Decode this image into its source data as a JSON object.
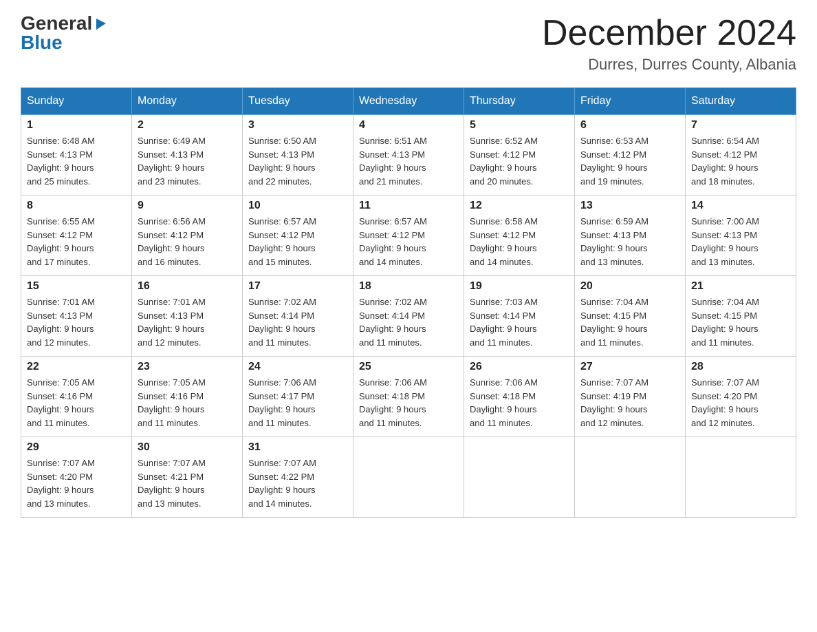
{
  "header": {
    "logo_general": "General",
    "logo_triangle": "▶",
    "logo_blue": "Blue",
    "month_title": "December 2024",
    "location": "Durres, Durres County, Albania"
  },
  "weekdays": [
    "Sunday",
    "Monday",
    "Tuesday",
    "Wednesday",
    "Thursday",
    "Friday",
    "Saturday"
  ],
  "weeks": [
    [
      {
        "day": "1",
        "sunrise": "6:48 AM",
        "sunset": "4:13 PM",
        "daylight": "9 hours and 25 minutes."
      },
      {
        "day": "2",
        "sunrise": "6:49 AM",
        "sunset": "4:13 PM",
        "daylight": "9 hours and 23 minutes."
      },
      {
        "day": "3",
        "sunrise": "6:50 AM",
        "sunset": "4:13 PM",
        "daylight": "9 hours and 22 minutes."
      },
      {
        "day": "4",
        "sunrise": "6:51 AM",
        "sunset": "4:13 PM",
        "daylight": "9 hours and 21 minutes."
      },
      {
        "day": "5",
        "sunrise": "6:52 AM",
        "sunset": "4:12 PM",
        "daylight": "9 hours and 20 minutes."
      },
      {
        "day": "6",
        "sunrise": "6:53 AM",
        "sunset": "4:12 PM",
        "daylight": "9 hours and 19 minutes."
      },
      {
        "day": "7",
        "sunrise": "6:54 AM",
        "sunset": "4:12 PM",
        "daylight": "9 hours and 18 minutes."
      }
    ],
    [
      {
        "day": "8",
        "sunrise": "6:55 AM",
        "sunset": "4:12 PM",
        "daylight": "9 hours and 17 minutes."
      },
      {
        "day": "9",
        "sunrise": "6:56 AM",
        "sunset": "4:12 PM",
        "daylight": "9 hours and 16 minutes."
      },
      {
        "day": "10",
        "sunrise": "6:57 AM",
        "sunset": "4:12 PM",
        "daylight": "9 hours and 15 minutes."
      },
      {
        "day": "11",
        "sunrise": "6:57 AM",
        "sunset": "4:12 PM",
        "daylight": "9 hours and 14 minutes."
      },
      {
        "day": "12",
        "sunrise": "6:58 AM",
        "sunset": "4:12 PM",
        "daylight": "9 hours and 14 minutes."
      },
      {
        "day": "13",
        "sunrise": "6:59 AM",
        "sunset": "4:13 PM",
        "daylight": "9 hours and 13 minutes."
      },
      {
        "day": "14",
        "sunrise": "7:00 AM",
        "sunset": "4:13 PM",
        "daylight": "9 hours and 13 minutes."
      }
    ],
    [
      {
        "day": "15",
        "sunrise": "7:01 AM",
        "sunset": "4:13 PM",
        "daylight": "9 hours and 12 minutes."
      },
      {
        "day": "16",
        "sunrise": "7:01 AM",
        "sunset": "4:13 PM",
        "daylight": "9 hours and 12 minutes."
      },
      {
        "day": "17",
        "sunrise": "7:02 AM",
        "sunset": "4:14 PM",
        "daylight": "9 hours and 11 minutes."
      },
      {
        "day": "18",
        "sunrise": "7:02 AM",
        "sunset": "4:14 PM",
        "daylight": "9 hours and 11 minutes."
      },
      {
        "day": "19",
        "sunrise": "7:03 AM",
        "sunset": "4:14 PM",
        "daylight": "9 hours and 11 minutes."
      },
      {
        "day": "20",
        "sunrise": "7:04 AM",
        "sunset": "4:15 PM",
        "daylight": "9 hours and 11 minutes."
      },
      {
        "day": "21",
        "sunrise": "7:04 AM",
        "sunset": "4:15 PM",
        "daylight": "9 hours and 11 minutes."
      }
    ],
    [
      {
        "day": "22",
        "sunrise": "7:05 AM",
        "sunset": "4:16 PM",
        "daylight": "9 hours and 11 minutes."
      },
      {
        "day": "23",
        "sunrise": "7:05 AM",
        "sunset": "4:16 PM",
        "daylight": "9 hours and 11 minutes."
      },
      {
        "day": "24",
        "sunrise": "7:06 AM",
        "sunset": "4:17 PM",
        "daylight": "9 hours and 11 minutes."
      },
      {
        "day": "25",
        "sunrise": "7:06 AM",
        "sunset": "4:18 PM",
        "daylight": "9 hours and 11 minutes."
      },
      {
        "day": "26",
        "sunrise": "7:06 AM",
        "sunset": "4:18 PM",
        "daylight": "9 hours and 11 minutes."
      },
      {
        "day": "27",
        "sunrise": "7:07 AM",
        "sunset": "4:19 PM",
        "daylight": "9 hours and 12 minutes."
      },
      {
        "day": "28",
        "sunrise": "7:07 AM",
        "sunset": "4:20 PM",
        "daylight": "9 hours and 12 minutes."
      }
    ],
    [
      {
        "day": "29",
        "sunrise": "7:07 AM",
        "sunset": "4:20 PM",
        "daylight": "9 hours and 13 minutes."
      },
      {
        "day": "30",
        "sunrise": "7:07 AM",
        "sunset": "4:21 PM",
        "daylight": "9 hours and 13 minutes."
      },
      {
        "day": "31",
        "sunrise": "7:07 AM",
        "sunset": "4:22 PM",
        "daylight": "9 hours and 14 minutes."
      },
      null,
      null,
      null,
      null
    ]
  ],
  "labels": {
    "sunrise": "Sunrise:",
    "sunset": "Sunset:",
    "daylight": "Daylight:"
  }
}
